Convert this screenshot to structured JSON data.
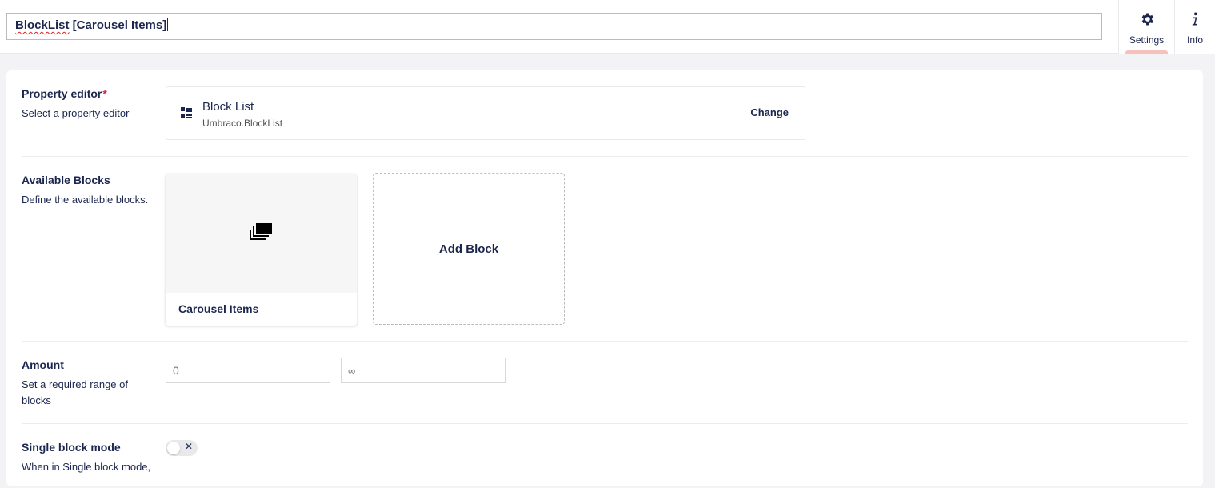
{
  "header": {
    "name_value_part1": "BlockList",
    "name_value_part2": " [Carousel Items]",
    "apps": [
      {
        "label": "Settings",
        "icon": "gear-icon",
        "active": true
      },
      {
        "label": "Info",
        "icon": "info-icon",
        "active": false
      }
    ]
  },
  "properties": {
    "property_editor": {
      "label": "Property editor",
      "required_mark": "*",
      "description": "Select a property editor",
      "selected_name": "Block List",
      "selected_alias": "Umbraco.BlockList",
      "change_label": "Change"
    },
    "available_blocks": {
      "label": "Available Blocks",
      "description": "Define the available blocks.",
      "blocks": [
        {
          "title": "Carousel Items",
          "icon": "layers-icon"
        }
      ],
      "add_label": "Add Block"
    },
    "amount": {
      "label": "Amount",
      "description": "Set a required range of blocks",
      "min_placeholder": "0",
      "separator": "–",
      "max_placeholder": "∞"
    },
    "single_block_mode": {
      "label": "Single block mode",
      "description": "When in Single block mode,",
      "enabled": false,
      "off_symbol": "✕"
    }
  },
  "colors": {
    "text": "#1b264f",
    "required": "#d42054",
    "active_indicator": "#f5c1bc",
    "background": "#f3f3f5"
  }
}
